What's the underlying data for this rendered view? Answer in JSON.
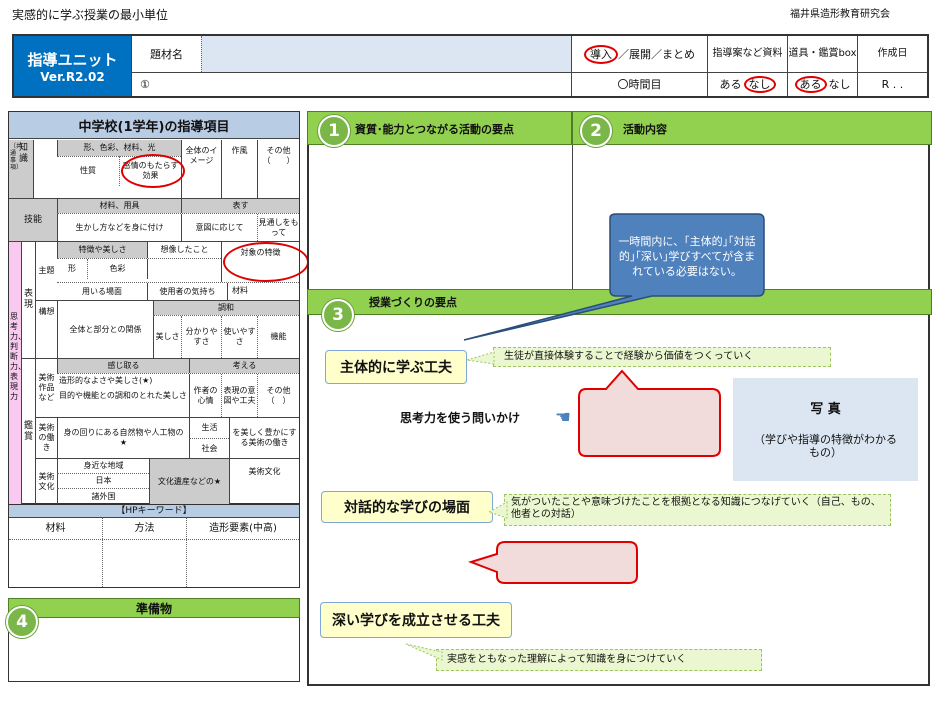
{
  "header": {
    "doc_title": "実感的に学ぶ授業の最小単位",
    "org": "福井県造形教育研究会"
  },
  "top_bar": {
    "unit_line1": "指導ユニット",
    "unit_line2": "Ver.R2.02",
    "subject_label": "題材名",
    "stage_intro": "導入",
    "stage_rest": "／展開／まとめ",
    "plan_label": "指導案など資料",
    "tool_label": "道具・鑑賞box",
    "date_label": "作成日",
    "circle_one": "①",
    "hours": "〇時間目",
    "aru": "ある",
    "nashi": "なし",
    "date_value": "R . ."
  },
  "grade_title": "中学校(1学年)の指導項目",
  "table": {
    "chishiki": "知識",
    "kyotsu": "〔共通事項〕",
    "k_h1": "形、色彩、材料、光",
    "k_h2": "全体のイメージ",
    "k_h3": "作風",
    "k_h4": "その他（　　）",
    "k_r1": "性質",
    "k_r2": "感情のもたらす効果",
    "ginou": "技能",
    "g_h1": "材料、用具",
    "g_h2": "表す",
    "g_r1": "生かし方などを身に付け",
    "g_r2": "意図に応じて",
    "g_r3": "見通しをもって",
    "shikou": "思考力、判断力、表現力",
    "hyogen": "表現",
    "shudai": "主題",
    "kousou": "構想",
    "s_h1": "特徴や美しさ",
    "s_h2": "想像したこと",
    "s_h3": "対象の特徴",
    "s_katachi": "形",
    "s_shikisai": "色彩",
    "s_r2a": "用いる場面",
    "s_r2b": "使用者の気持ち",
    "s_r2c": "材料",
    "ko_r1": "全体と部分との関係",
    "ko_chowa": "調和",
    "ko_c1": "美しさ",
    "ko_c2": "分かりやすさ",
    "ko_c3": "使いやすさ",
    "ko_c4": "機能",
    "kansho": "鑑賞",
    "bijutsu_sakuhin": "美術作品など",
    "ka_h1": "感じ取る",
    "ka_h2": "考える",
    "ka_r1": "造形的なよさや美しさ(★)",
    "ka_r2": "目的や機能との調和のとれた美しさ",
    "ka_c1": "作者の心情",
    "ka_c2": "表現の意図や工夫",
    "ka_c3": "その他（　）",
    "bijutsu_hataraki": "美術の働き",
    "bh_r1": "身の回りにある自然物や人工物の★",
    "bh_c1": "生活",
    "bh_c2": "社会",
    "bh_c3": "を美しく豊かにする美術の働き",
    "bijutsu_bunka": "美術文化",
    "bb_r1": "身近な地域",
    "bb_r2": "日本",
    "bb_r3": "諸外国",
    "bb_c1": "文化遺産などの★",
    "bb_c2": "美術文化"
  },
  "hp": {
    "title": "【HPキーワード】",
    "col1": "材料",
    "col2": "方法",
    "col3": "造形要素(中高)"
  },
  "prep": {
    "num": "4",
    "title": "準備物"
  },
  "section1": {
    "num": "1",
    "title": "資質･能力とつながる活動の要点"
  },
  "section2": {
    "num": "2",
    "title": "活動内容"
  },
  "section3": {
    "num": "3",
    "title": "授業づくりの要点"
  },
  "callout": "一時間内に、｢主体的｣｢対話的｣｢深い｣学びすべてが含まれている必要はない。",
  "points": {
    "p1_title": "主体的に学ぶ工夫",
    "p1_desc": "生徒が直接体験することで経験から価値をつくっていく",
    "question_label": "思考力を使う問いかけ",
    "p2_title": "対話的な学びの場面",
    "p2_desc": "気がついたことや意味づけたことを根拠となる知識につなげていく（自己、もの、他者との対話）",
    "p3_title": "深い学びを成立させる工夫",
    "p3_desc": "実感をともなった理解によって知識を身につけていく"
  },
  "photo": {
    "title": "写 真",
    "desc": "（学びや指導の特徴がわかるもの）"
  },
  "colors": {
    "accent_green": "#92d050",
    "header_blue": "#0070c0",
    "red_ring": "#e00000",
    "pink_fill": "#f2dcdb"
  }
}
